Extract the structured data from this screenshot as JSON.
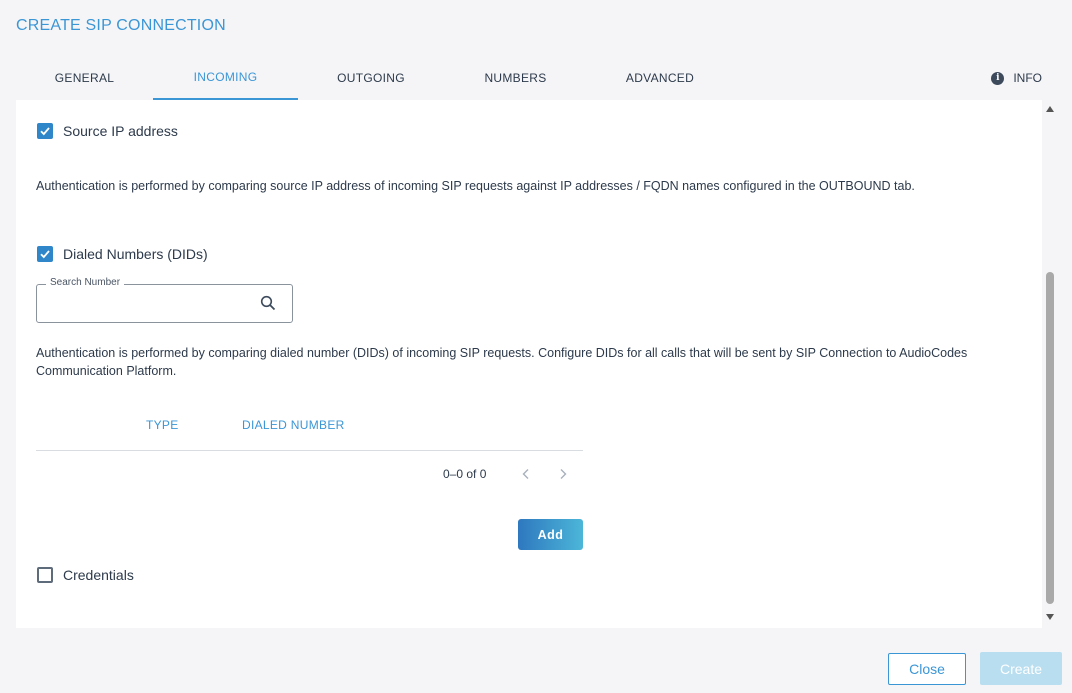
{
  "dialog": {
    "title": "CREATE SIP CONNECTION"
  },
  "tabs": [
    {
      "label": "GENERAL"
    },
    {
      "label": "INCOMING",
      "active": true
    },
    {
      "label": "OUTGOING"
    },
    {
      "label": "NUMBERS"
    },
    {
      "label": "ADVANCED"
    }
  ],
  "info_tab": {
    "label": "INFO",
    "icon": "info-icon"
  },
  "source_ip": {
    "label": "Source IP address",
    "checked": true,
    "description": "Authentication is performed by comparing source IP address of incoming SIP requests against IP addresses / FQDN names configured in the OUTBOUND tab."
  },
  "dids": {
    "label": "Dialed Numbers (DIDs)",
    "checked": true,
    "search_label": "Search Number",
    "search_value": "",
    "description": "Authentication is performed by comparing dialed number (DIDs) of incoming SIP requests. Configure DIDs for all calls that will be sent by SIP Connection to AudioCodes Communication Platform.",
    "table": {
      "columns": [
        "TYPE",
        "DIALED NUMBER"
      ],
      "rows": []
    },
    "pager": {
      "text": "0–0 of 0"
    },
    "add_label": "Add"
  },
  "credentials": {
    "label": "Credentials",
    "checked": false
  },
  "footer": {
    "close_label": "Close",
    "create_label": "Create"
  },
  "colors": {
    "accent": "#3b96d6",
    "checkbox": "#2f86c9",
    "create_disabled": "#b9def0"
  }
}
